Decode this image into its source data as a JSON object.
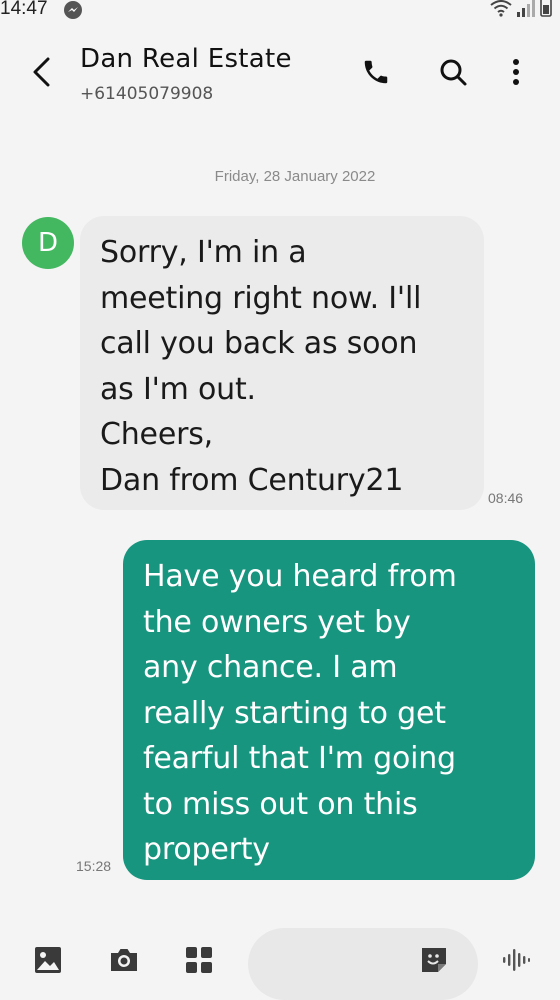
{
  "status_bar": {
    "time": "14:47",
    "icons": [
      "messenger-icon",
      "wifi-icon",
      "signal-icon",
      "battery-icon"
    ]
  },
  "header": {
    "contact_name": "Dan Real Estate",
    "contact_number": "+61405079908",
    "icons": [
      "back-arrow-icon",
      "phone-icon",
      "search-icon",
      "more-vertical-icon"
    ]
  },
  "conversation": {
    "date_separator": "Friday, 28 January 2022",
    "avatar_letter": "D",
    "messages": [
      {
        "direction": "incoming",
        "text": "Sorry, I'm in a\nmeeting right now. I'll\ncall you back as soon\nas I'm out.\nCheers,\nDan from Century21",
        "time": "08:46"
      },
      {
        "direction": "outgoing",
        "text": "Have you heard from\nthe owners yet by\nany chance. I am\nreally starting to get\nfearful that I'm going\nto miss out on this\nproperty",
        "time": "15:28"
      }
    ]
  },
  "composer": {
    "message_value": "",
    "icons": [
      "image-icon",
      "camera-icon",
      "apps-grid-icon",
      "sticker-icon",
      "voice-icon"
    ]
  },
  "colors": {
    "outgoing_bubble": "#18957f",
    "incoming_bubble": "#ebebeb",
    "avatar": "#43b860",
    "background": "#f4f4f4"
  }
}
